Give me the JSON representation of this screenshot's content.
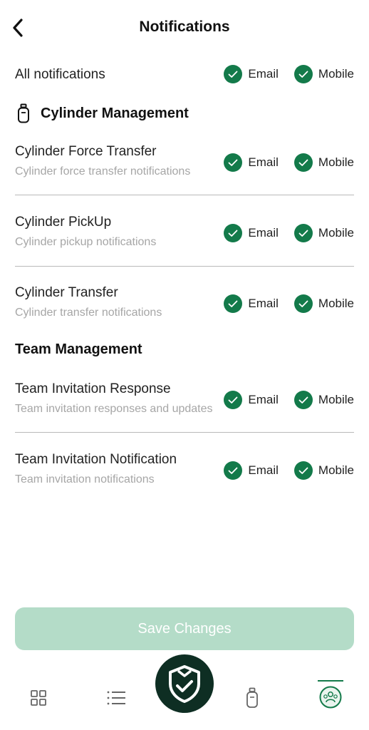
{
  "header": {
    "title": "Notifications"
  },
  "all_notifications": {
    "label": "All notifications",
    "email_label": "Email",
    "mobile_label": "Mobile",
    "email_checked": true,
    "mobile_checked": true
  },
  "sections": [
    {
      "title": "Cylinder Management",
      "items": [
        {
          "title": "Cylinder Force Transfer",
          "subtitle": "Cylinder force transfer notifications",
          "email_label": "Email",
          "mobile_label": "Mobile",
          "email_checked": true,
          "mobile_checked": true
        },
        {
          "title": "Cylinder PickUp",
          "subtitle": "Cylinder pickup notifications",
          "email_label": "Email",
          "mobile_label": "Mobile",
          "email_checked": true,
          "mobile_checked": true
        },
        {
          "title": "Cylinder Transfer",
          "subtitle": "Cylinder transfer notifications",
          "email_label": "Email",
          "mobile_label": "Mobile",
          "email_checked": true,
          "mobile_checked": true
        }
      ]
    },
    {
      "title": "Team Management",
      "items": [
        {
          "title": "Team Invitation Response",
          "subtitle": "Team invitation responses and updates",
          "email_label": "Email",
          "mobile_label": "Mobile",
          "email_checked": true,
          "mobile_checked": true
        },
        {
          "title": "Team Invitation Notification",
          "subtitle": "Team invitation notifications",
          "email_label": "Email",
          "mobile_label": "Mobile",
          "email_checked": true,
          "mobile_checked": true
        }
      ]
    }
  ],
  "save_button": {
    "label": "Save Changes",
    "enabled": false
  },
  "bottom_nav": {
    "items": [
      {
        "icon": "grid-icon"
      },
      {
        "icon": "list-icon"
      },
      {
        "icon": "shield-check-icon"
      },
      {
        "icon": "cylinder-icon"
      },
      {
        "icon": "team-avatar-icon",
        "active": true
      }
    ]
  },
  "colors": {
    "accent": "#137a4a",
    "button_disabled": "#b4dcc8",
    "center_button": "#0e2e23",
    "subtitle": "#a6a6a6",
    "divider": "#b9b9b9"
  }
}
